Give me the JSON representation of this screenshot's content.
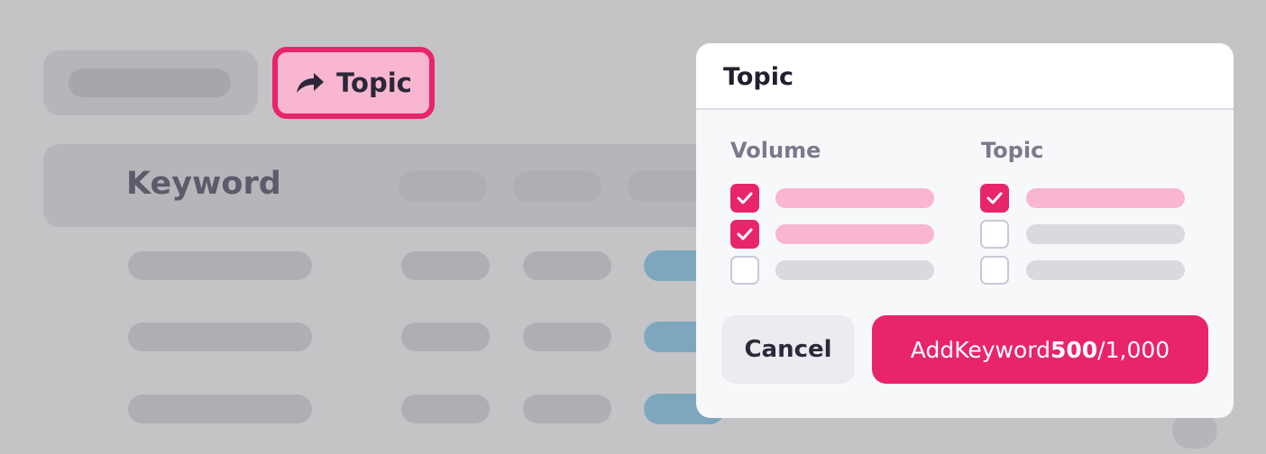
{
  "toolbar": {
    "topic_button_label": "Topic",
    "topic_button_icon": "share-arrow-icon"
  },
  "table": {
    "keyword_header": "Keyword"
  },
  "modal": {
    "title": "Topic",
    "columns": [
      {
        "heading": "Volume",
        "options": [
          {
            "checked": true
          },
          {
            "checked": true
          },
          {
            "checked": false
          }
        ]
      },
      {
        "heading": "Topic",
        "options": [
          {
            "checked": true
          },
          {
            "checked": false
          },
          {
            "checked": false
          }
        ]
      }
    ],
    "cancel_label": "Cancel",
    "add": {
      "prefix": "Add",
      "noun": "Keyword",
      "selected": "500",
      "separator": "/",
      "limit": "1,000"
    }
  },
  "colors": {
    "accent": "#e8246c",
    "accent_light": "#f8b6d0",
    "overlay": "#c4c4c6"
  }
}
